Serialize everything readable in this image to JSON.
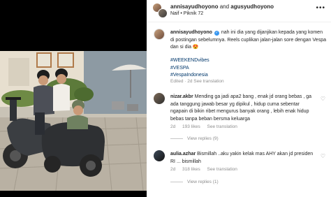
{
  "post_header": {
    "collab_title_user1": "annisayudhoyono",
    "collab_title_and": "and",
    "collab_title_user2": "agusyudhoyono",
    "audio_label": "Naif • Piknik 72"
  },
  "caption": {
    "username": "annisayudhoyono",
    "verified_icon": "✓",
    "text": "nah ini dia yang dijanjikan kepada yang komen di postingan sebelumnya. Reels cuplikan jalan-jalan sore dengan Vespa dan si dia 😍",
    "hashtags": [
      "#WEEKENDvibes",
      "#VESPA",
      "#VespaIndonesia"
    ],
    "meta": "Edited · 2d   See translation"
  },
  "comments": [
    {
      "username": "nizar.akbr",
      "text": "Mending ga jadi apa2 bang , enak jd orang bebas , ga ada tanggung jawab besar yg dipikul , hidup cuma sebentar ngapain di bikin ribet mengurus banyak orang , lebih enak hidup bebas tanpa beban bersma keluarga",
      "age": "2d",
      "likes": "193 likes",
      "translate": "See translation",
      "replies": "View replies (9)"
    },
    {
      "username": "aulia.azhar",
      "text": "Bismillah ..aku yakin kelak mas AHY akan jd presiden RI ... bismillah",
      "age": "2d",
      "likes": "318 likes",
      "translate": "See translation",
      "replies": "View replies (1)"
    }
  ],
  "icons": {
    "more": "•••",
    "heart": "♡"
  }
}
